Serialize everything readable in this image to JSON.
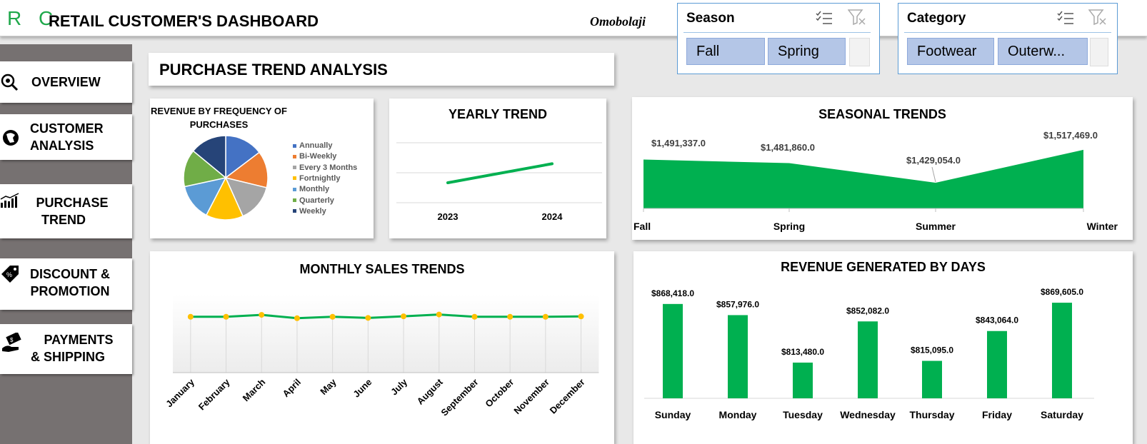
{
  "header": {
    "logo": "R C",
    "title": "RETAIL CUSTOMER'S DASHBOARD",
    "author": "Omobolaji"
  },
  "nav": {
    "overview": "OVERVIEW",
    "customer_analysis_1": "CUSTOMER",
    "customer_analysis_2": "ANALYSIS",
    "purchase_trend_1": "PURCHASE",
    "purchase_trend_2": "TREND",
    "discount_1": "DISCOUNT &",
    "discount_2": "PROMOTION",
    "payments_1": "PAYMENTS",
    "payments_2": "& SHIPPING"
  },
  "page_title": "PURCHASE TREND ANALYSIS",
  "slicers": {
    "season": {
      "title": "Season",
      "items": [
        "Fall",
        "Spring"
      ]
    },
    "category": {
      "title": "Category",
      "items": [
        "Footwear",
        "Outerw..."
      ]
    }
  },
  "colors": {
    "green": "#00b050",
    "marker": "#ffc000",
    "slicer_chip": "#b4c6e7",
    "sidebar": "#767171"
  },
  "chart_data": [
    {
      "type": "pie",
      "title_line1": "REVENUE BY FREQUENCY OF",
      "title_line2": "PURCHASES",
      "categories": [
        "Annually",
        "Bi-Weekly",
        "Every 3 Months",
        "Fortnightly",
        "Monthly",
        "Quarterly",
        "Weekly"
      ],
      "values": [
        14.7,
        14.1,
        14.5,
        14.3,
        14.0,
        14.4,
        14.0
      ],
      "colors": [
        "#4472c4",
        "#ed7d31",
        "#a5a5a5",
        "#ffc000",
        "#5b9bd5",
        "#70ad47",
        "#264478"
      ]
    },
    {
      "type": "line",
      "title": "YEARLY TREND",
      "categories": [
        "2023",
        "2024"
      ],
      "values": [
        2000000,
        3900000
      ],
      "ylim": [
        0,
        6000000
      ]
    },
    {
      "type": "area",
      "title": "SEASONAL TRENDS",
      "categories": [
        "Fall",
        "Spring",
        "Summer",
        "Winter"
      ],
      "values": [
        1491337.0,
        1481860.0,
        1429054.0,
        1517469.0
      ],
      "labels": [
        "$1,491,337.0",
        "$1,481,860.0",
        "$1,429,054.0",
        "$1,517,469.0"
      ],
      "ylim": [
        1360000,
        1525000
      ]
    },
    {
      "type": "line",
      "title": "MONTHLY SALES TRENDS",
      "categories": [
        "January",
        "February",
        "March",
        "April",
        "May",
        "June",
        "July",
        "August",
        "September",
        "October",
        "November",
        "December"
      ],
      "values": [
        498000,
        498000,
        515000,
        485000,
        498000,
        488000,
        502000,
        518000,
        498000,
        498000,
        498000,
        501000
      ],
      "ylim": [
        0,
        700000
      ]
    },
    {
      "type": "bar",
      "title": "REVENUE GENERATED BY DAYS",
      "categories": [
        "Sunday",
        "Monday",
        "Tuesday",
        "Wednesday",
        "Thursday",
        "Friday",
        "Saturday"
      ],
      "values": [
        868418.0,
        857976.0,
        813480.0,
        852082.0,
        815095.0,
        843064.0,
        869605.0
      ],
      "labels": [
        "$868,418.0",
        "$857,976.0",
        "$813,480.0",
        "$852,082.0",
        "$815,095.0",
        "$843,064.0",
        "$869,605.0"
      ],
      "ylim": [
        780000,
        875000
      ]
    }
  ]
}
